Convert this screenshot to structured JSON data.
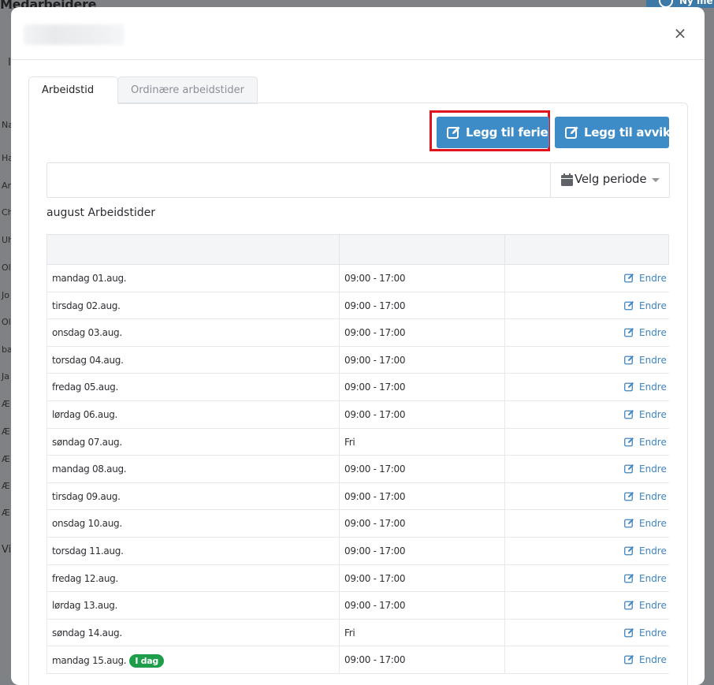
{
  "background": {
    "page_title": "Medarbeidere",
    "new_button_label": "Ny me",
    "side_letters": [
      "I",
      "Na",
      "Ha",
      "An",
      "Ch",
      "Uh",
      "Ol",
      "Jo",
      "Ol",
      "ba",
      "Ja",
      "Æ",
      "Æ",
      "Æ",
      "Æ",
      "Æ",
      "Vis"
    ]
  },
  "modal": {
    "close_label": "×",
    "tabs": [
      {
        "label": "Arbeidstid",
        "active": true
      },
      {
        "label": "Ordinære arbeidstider",
        "active": false
      }
    ],
    "buttons": {
      "add_vacation": "Legg til ferie",
      "add_deviation": "Legg til avvik"
    },
    "period": {
      "input_value": "",
      "select_label": "Velg periode"
    },
    "section_heading": "august Arbeidstider",
    "edit_label": "Endre",
    "rows": [
      {
        "day": "mandag 01.aug.",
        "hours": "09:00 - 17:00"
      },
      {
        "day": "tirsdag 02.aug.",
        "hours": "09:00 - 17:00"
      },
      {
        "day": "onsdag 03.aug.",
        "hours": "09:00 - 17:00"
      },
      {
        "day": "torsdag 04.aug.",
        "hours": "09:00 - 17:00"
      },
      {
        "day": "fredag 05.aug.",
        "hours": "09:00 - 17:00"
      },
      {
        "day": "lørdag 06.aug.",
        "hours": "09:00 - 17:00"
      },
      {
        "day": "søndag 07.aug.",
        "hours": "Fri"
      },
      {
        "day": "mandag 08.aug.",
        "hours": "09:00 - 17:00"
      },
      {
        "day": "tirsdag 09.aug.",
        "hours": "09:00 - 17:00"
      },
      {
        "day": "onsdag 10.aug.",
        "hours": "09:00 - 17:00"
      },
      {
        "day": "torsdag 11.aug.",
        "hours": "09:00 - 17:00"
      },
      {
        "day": "fredag 12.aug.",
        "hours": "09:00 - 17:00"
      },
      {
        "day": "lørdag 13.aug.",
        "hours": "09:00 - 17:00"
      },
      {
        "day": "søndag 14.aug.",
        "hours": "Fri"
      },
      {
        "day": "mandag 15.aug.",
        "hours": "09:00 - 17:00",
        "badge": "I dag"
      }
    ],
    "colors": {
      "primary_button": "#3e8cc7",
      "highlight_border": "#e0121b",
      "edit_link": "#3d84c0",
      "today_badge": "#1e9e4a"
    }
  }
}
